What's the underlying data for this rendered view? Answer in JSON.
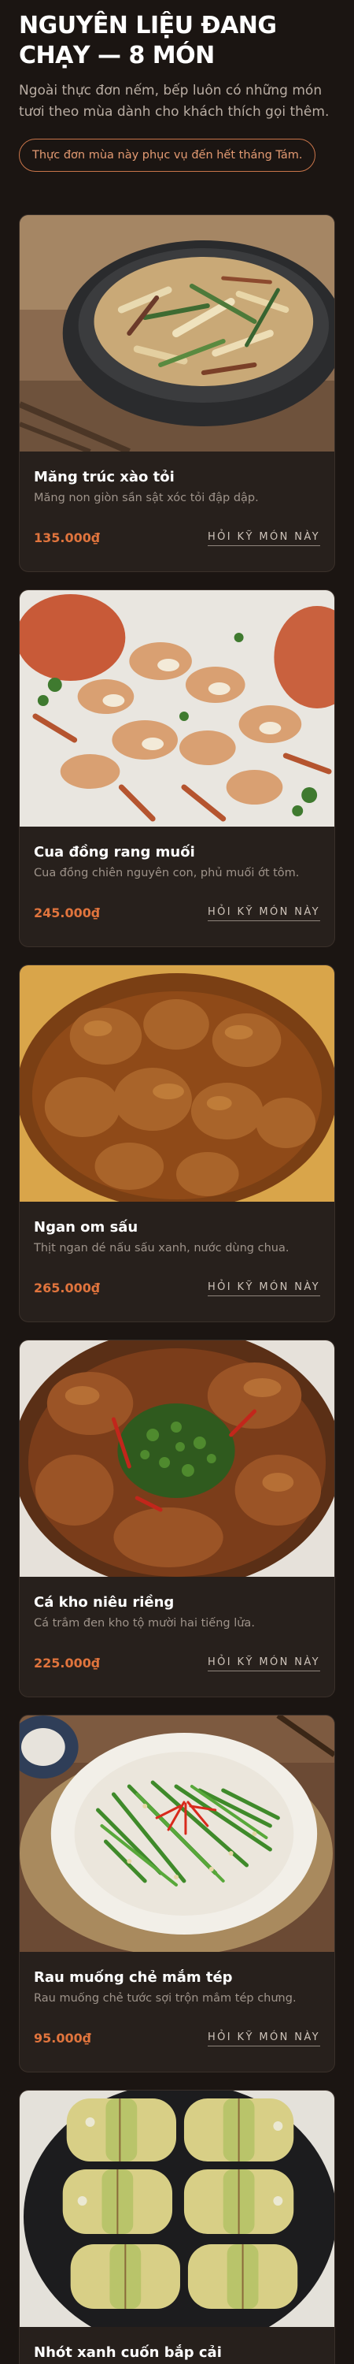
{
  "header": {
    "title": "Nguyên liệu đang chạy — 8 món",
    "subtitle": "Ngoài thực đơn nếm, bếp luôn có những món tươi theo mùa dành cho khách thích gọi thêm.",
    "notice": "Thực đơn mùa này phục vụ đến hết tháng Tám."
  },
  "colors": {
    "background": "#1b1512",
    "card": "#27201c",
    "accent": "#e0743d",
    "notice_border": "#c9754a"
  },
  "dishes": [
    {
      "name": "Măng trúc xào tỏi",
      "description": "Măng non giòn sần sật xóc tỏi đập dập.",
      "price": "135.000₫",
      "action": "Hỏi kỹ món này"
    },
    {
      "name": "Cua đồng rang muối",
      "description": "Cua đồng chiên nguyên con, phủ muối ớt tôm.",
      "price": "245.000₫",
      "action": "Hỏi kỹ món này"
    },
    {
      "name": "Ngan om sấu",
      "description": "Thịt ngan dé nấu sấu xanh, nước dùng chua.",
      "price": "265.000₫",
      "action": "Hỏi kỹ món này"
    },
    {
      "name": "Cá kho niêu riềng",
      "description": "Cá trắm đen kho tộ mười hai tiếng lửa.",
      "price": "225.000₫",
      "action": "Hỏi kỹ món này"
    },
    {
      "name": "Rau muống chẻ mắm tép",
      "description": "Rau muống chẻ tước sợi trộn mắm tép chưng.",
      "price": "95.000₫",
      "action": "Hỏi kỹ món này"
    },
    {
      "name": "Nhót xanh cuốn bắp cải",
      "description": "",
      "price": "",
      "action": ""
    }
  ]
}
